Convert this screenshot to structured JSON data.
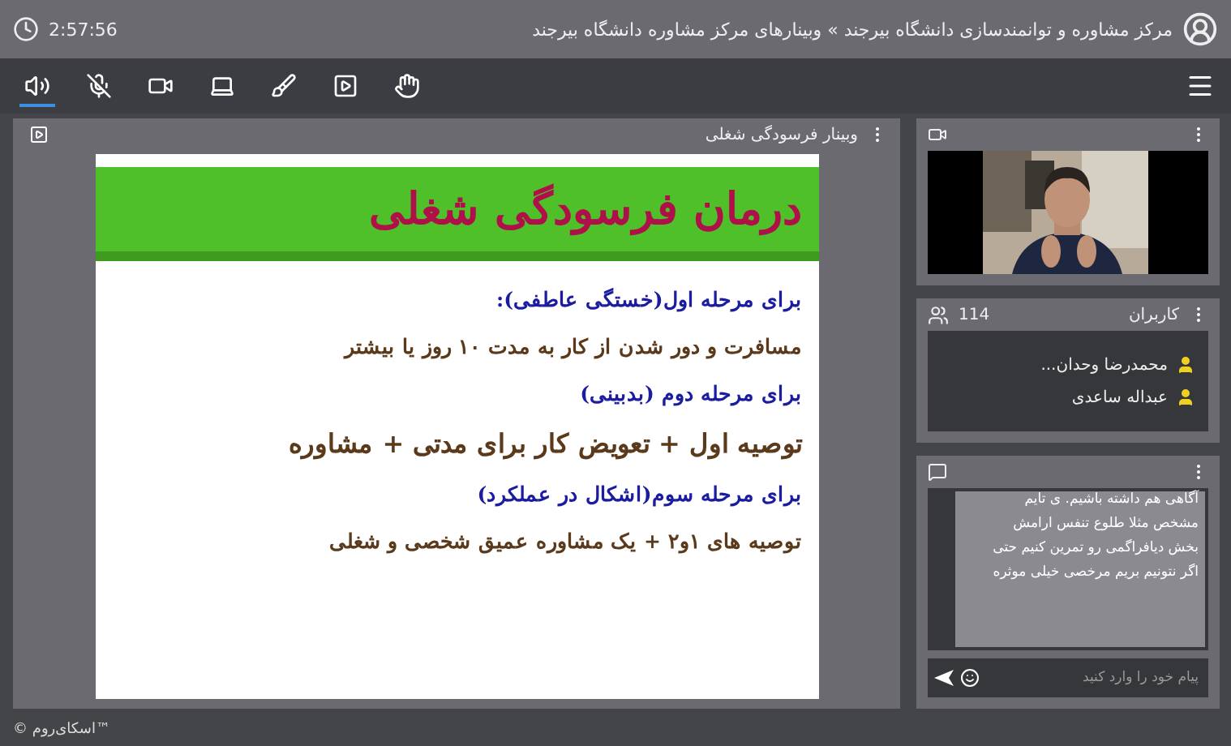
{
  "header": {
    "time": "2:57:56",
    "breadcrumb": "مرکز مشاوره و توانمندسازی دانشگاه بیرجند » وبینارهای مرکز مشاوره دانشگاه بیرجند"
  },
  "toolbar": [
    {
      "kind": "speaker",
      "selected": true
    },
    {
      "kind": "mic-off",
      "selected": false
    },
    {
      "kind": "camera",
      "selected": false
    },
    {
      "kind": "screen",
      "selected": false
    },
    {
      "kind": "brush",
      "selected": false
    },
    {
      "kind": "play",
      "selected": false
    },
    {
      "kind": "hand",
      "selected": false
    }
  ],
  "presentation": {
    "title": "وبینار فرسودگی شغلی",
    "slide": {
      "heading": "درمان فرسودگی شغلی",
      "lines": [
        {
          "kind": "subhead",
          "text": "برای مرحله اول(خستگی عاطفی):"
        },
        {
          "kind": "body",
          "text": "مسافرت و دور شدن از کار به مدت ۱۰ روز یا بیشتر"
        },
        {
          "kind": "subhead",
          "text": "برای مرحله دوم (بدبینی)"
        },
        {
          "kind": "large",
          "text": "توصیه اول + تعویض کار برای مدتی + مشاوره"
        },
        {
          "kind": "subhead",
          "text": "برای مرحله سوم(اشکال در عملکرد)"
        },
        {
          "kind": "body",
          "text": "توصیه های ۱و۲ + یک مشاوره عمیق شخصی و شغلی"
        }
      ]
    }
  },
  "users": {
    "title": "کاربران",
    "count": "114",
    "items": [
      {
        "name": "محمدرضا وحدان..."
      },
      {
        "name": "عبداله ساعدی"
      }
    ]
  },
  "chat": {
    "message_lines": [
      "آگاهی  هم داشته باشیم. ی تایم",
      "مشخص مثلا طلوع تنفس  ارامش",
      "بخش دیافراگمی رو تمرین کنیم حتی",
      "اگر نتونیم بریم مرخصی خیلی موثره"
    ],
    "placeholder": "پیام خود را وارد کنید"
  },
  "footer": "© اسکای‌روم™"
}
